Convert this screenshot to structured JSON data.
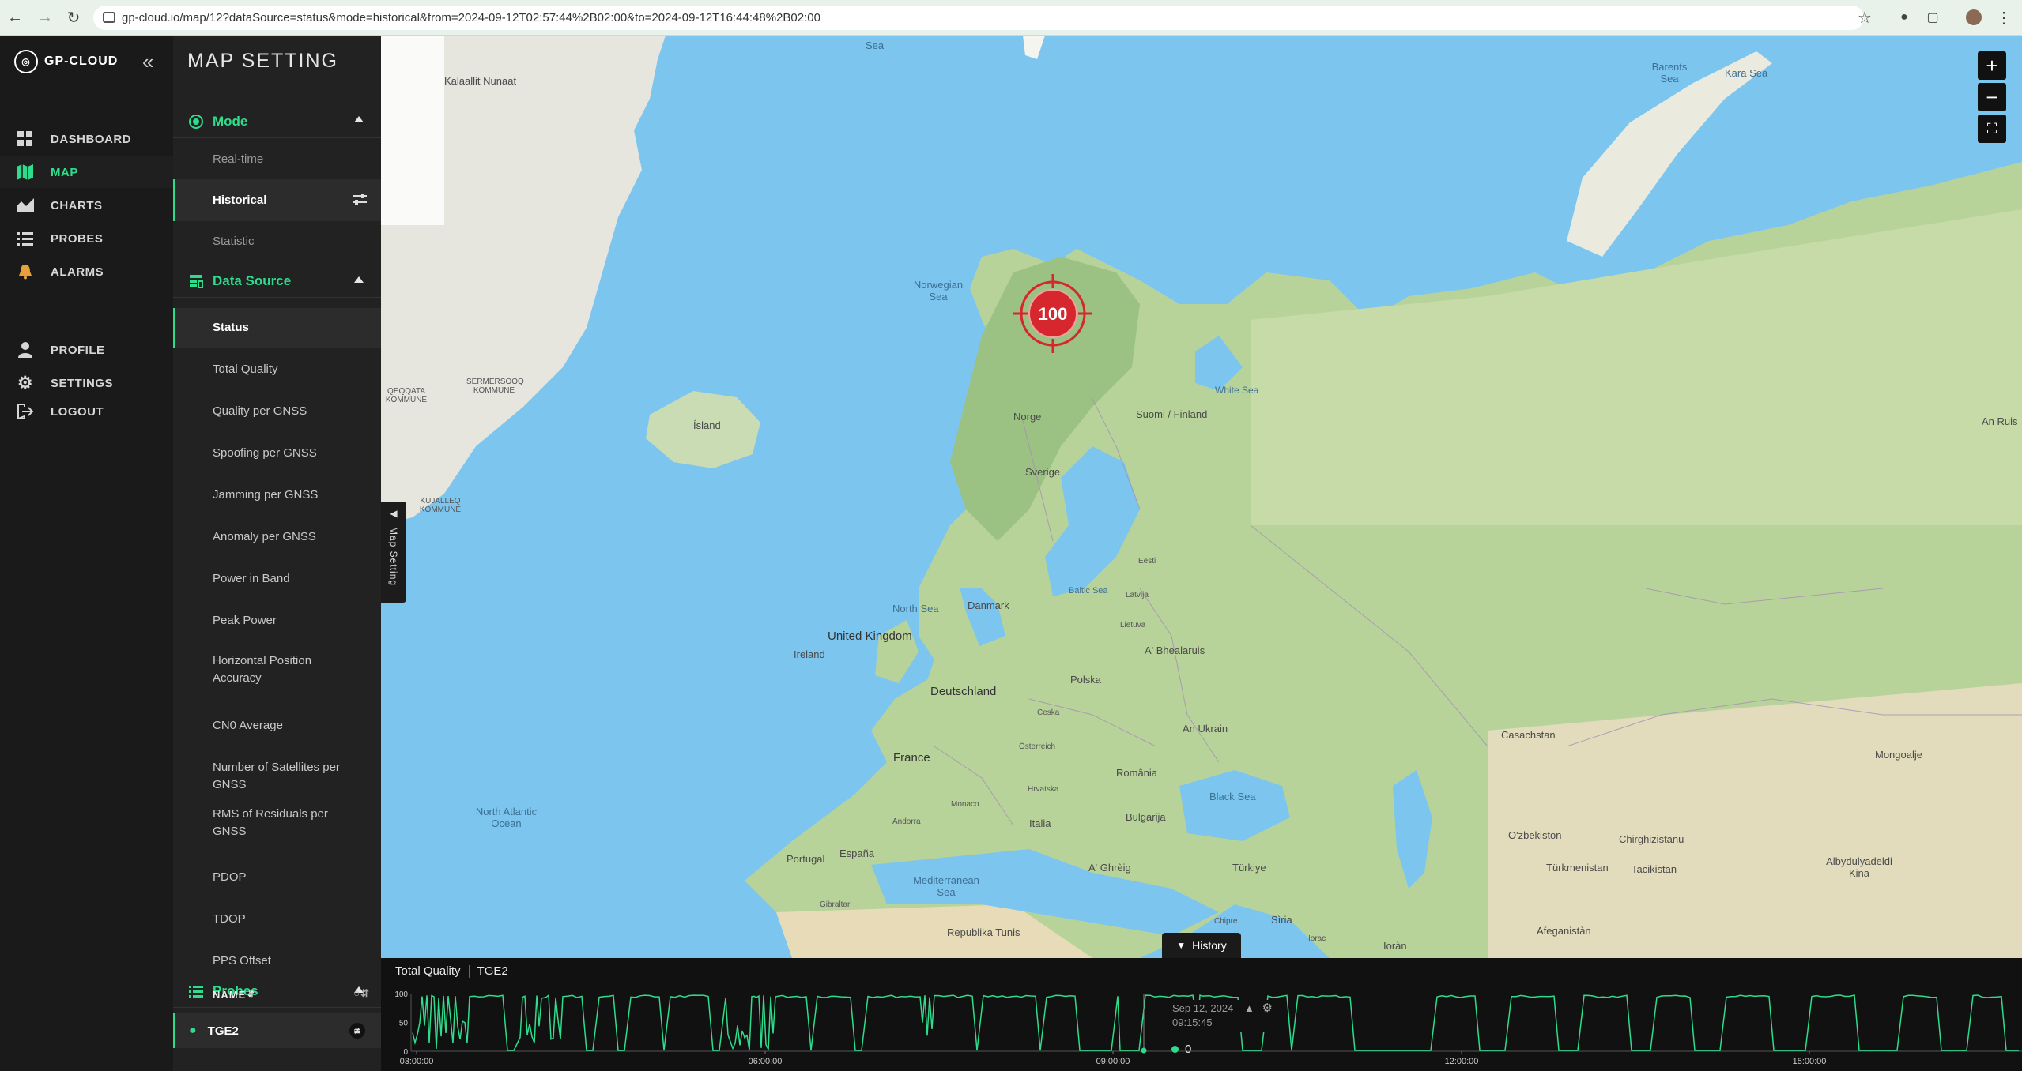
{
  "browser": {
    "url": "gp-cloud.io/map/12?dataSource=status&mode=historical&from=2024-09-12T02:57:44%2B02:00&to=2024-09-12T16:44:48%2B02:00"
  },
  "nav": {
    "logo": "GP-CLOUD",
    "items": [
      {
        "label": "DASHBOARD",
        "icon": "dashboard-icon"
      },
      {
        "label": "MAP",
        "icon": "map-icon"
      },
      {
        "label": "CHARTS",
        "icon": "chart-icon"
      },
      {
        "label": "PROBES",
        "icon": "list-icon"
      },
      {
        "label": "ALARMS",
        "icon": "bell-icon"
      },
      {
        "label": "PROFILE",
        "icon": "user-icon"
      },
      {
        "label": "SETTINGS",
        "icon": "gear-icon"
      },
      {
        "label": "LOGOUT",
        "icon": "logout-icon"
      }
    ]
  },
  "panel": {
    "title": "MAP SETTING",
    "mode": {
      "label": "Mode",
      "options": [
        "Real-time",
        "Historical",
        "Statistic"
      ],
      "selected": "Historical"
    },
    "data_source": {
      "label": "Data Source",
      "options": [
        "Status",
        "Total Quality",
        "Quality per GNSS",
        "Spoofing per GNSS",
        "Jamming per GNSS",
        "Anomaly per GNSS",
        "Power in Band",
        "Peak Power",
        "Horizontal Position Accuracy",
        "CN0 Average",
        "Number of Satellites per GNSS",
        "RMS of Residuals per GNSS",
        "PDOP",
        "TDOP",
        "PPS Offset"
      ],
      "selected": "Status"
    },
    "probes": {
      "label": "Probes",
      "column": "NAME",
      "items": [
        "TGE2"
      ]
    }
  },
  "map": {
    "marker_value": "100",
    "side_tab": "Map Setting",
    "history_button": "History",
    "labels": [
      {
        "t": "Kalaallit Nunaat"
      },
      {
        "t": "Barents Sea"
      },
      {
        "t": "Kara Sea"
      },
      {
        "t": "Norwegian Sea"
      },
      {
        "t": "Ísland"
      },
      {
        "t": "Norge"
      },
      {
        "t": "Sverige"
      },
      {
        "t": "Suomi / Finland"
      },
      {
        "t": "White Sea"
      },
      {
        "t": "North Sea"
      },
      {
        "t": "United Kingdom"
      },
      {
        "t": "Ireland"
      },
      {
        "t": "Danmark"
      },
      {
        "t": "Deutschland"
      },
      {
        "t": "Polska"
      },
      {
        "t": "France"
      },
      {
        "t": "España"
      },
      {
        "t": "Portugal"
      },
      {
        "t": "Italia"
      },
      {
        "t": "Black Sea"
      },
      {
        "t": "Türkiye"
      },
      {
        "t": "North Atlantic Ocean"
      },
      {
        "t": "Mediterranean Sea"
      },
      {
        "t": "Casachstan"
      },
      {
        "t": "Mongoalje"
      },
      {
        "t": "An Ukrain"
      },
      {
        "t": "A' Bhealaruis"
      },
      {
        "t": "Eesti"
      },
      {
        "t": "Latvija"
      },
      {
        "t": "Lietuva"
      },
      {
        "t": "Baltic Sea"
      },
      {
        "t": "România"
      },
      {
        "t": "Bulgarija"
      },
      {
        "t": "Ceska"
      },
      {
        "t": "Österreich"
      },
      {
        "t": "Hrvatska"
      },
      {
        "t": "Monaco"
      },
      {
        "t": "Andorra"
      },
      {
        "t": "Gibraltar"
      },
      {
        "t": "Republika Tunis"
      },
      {
        "t": "Ioràn"
      },
      {
        "t": "Afeganistàn"
      },
      {
        "t": "Türkmenistan"
      },
      {
        "t": "O'zbekiston"
      },
      {
        "t": "Chirghizistanu"
      },
      {
        "t": "Tacikistan"
      },
      {
        "t": "Albydulyadeldi Kina"
      },
      {
        "t": "An Ruis"
      },
      {
        "t": "A' Ghrèig"
      },
      {
        "t": "Sìria"
      },
      {
        "t": "Iorac"
      },
      {
        "t": "Chipre"
      },
      {
        "t": "SERMERSOOQ KOMMUNE"
      },
      {
        "t": "QEQQATA KOMMUNE"
      },
      {
        "t": "KUJALLEQ KOMMUNE"
      },
      {
        "t": "Sea"
      }
    ]
  },
  "bottom": {
    "datasource": "Total Quality",
    "probe": "TGE2",
    "tooltip_date": "Sep 12, 2024",
    "tooltip_time": "09:15:45",
    "tooltip_value": "0"
  },
  "chart_data": {
    "type": "line",
    "title": "Total Quality",
    "ylim": [
      0,
      100
    ],
    "yticks": [
      "100",
      "50",
      "0"
    ],
    "xticks": [
      "03:00:00",
      "06:00:00",
      "09:00:00",
      "12:00:00",
      "15:00:00"
    ],
    "series": [
      {
        "name": "TGE2",
        "color": "#2fdc8c"
      }
    ]
  }
}
